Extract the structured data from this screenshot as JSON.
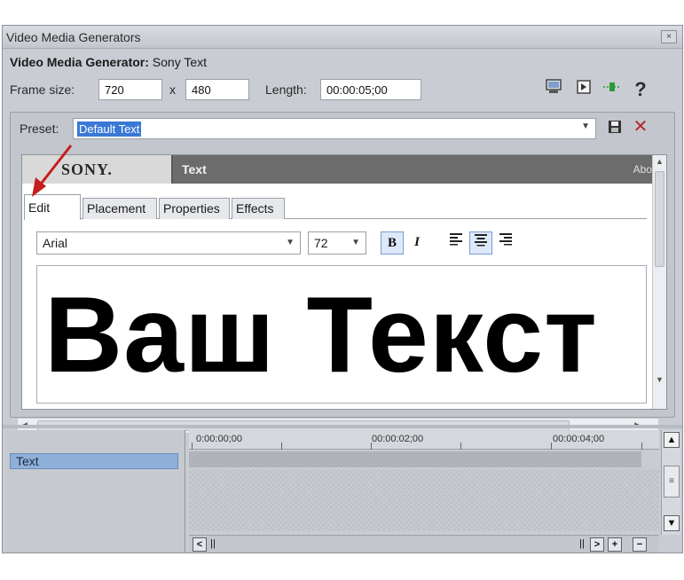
{
  "window": {
    "title": "Video Media Generators",
    "close_glyph": "×"
  },
  "generator": {
    "label": "Video Media Generator:",
    "value": "Sony Text"
  },
  "frame": {
    "frame_size_label": "Frame size:",
    "width": "720",
    "x_label": "x",
    "height": "480",
    "length_label": "Length:",
    "length": "00:00:05;00",
    "toolbar_icons": [
      "screen-icon",
      "frame-icon",
      "keyframe-icon",
      "help-icon"
    ],
    "help_glyph": "?"
  },
  "preset": {
    "label": "Preset:",
    "value": "Default Text"
  },
  "plugin": {
    "brand": "SONY.",
    "title": "Text",
    "about": "Abo",
    "tabs": [
      {
        "label": "Edit",
        "active": true
      },
      {
        "label": "Placement",
        "active": false
      },
      {
        "label": "Properties",
        "active": false
      },
      {
        "label": "Effects",
        "active": false
      }
    ],
    "font": "Arial",
    "size": "72",
    "bold_glyph": "B",
    "italic_glyph": "I",
    "alignment": "center",
    "text": "Ваш Текст"
  },
  "timeline": {
    "track_label": "Text",
    "ticks": [
      "0:00:00;00",
      "00:00:02;00",
      "00:00:04;00"
    ]
  },
  "colors": {
    "selection": "#3a78d6",
    "delete": "#b02a2a",
    "annotation_arrow": "#c61d1d"
  }
}
